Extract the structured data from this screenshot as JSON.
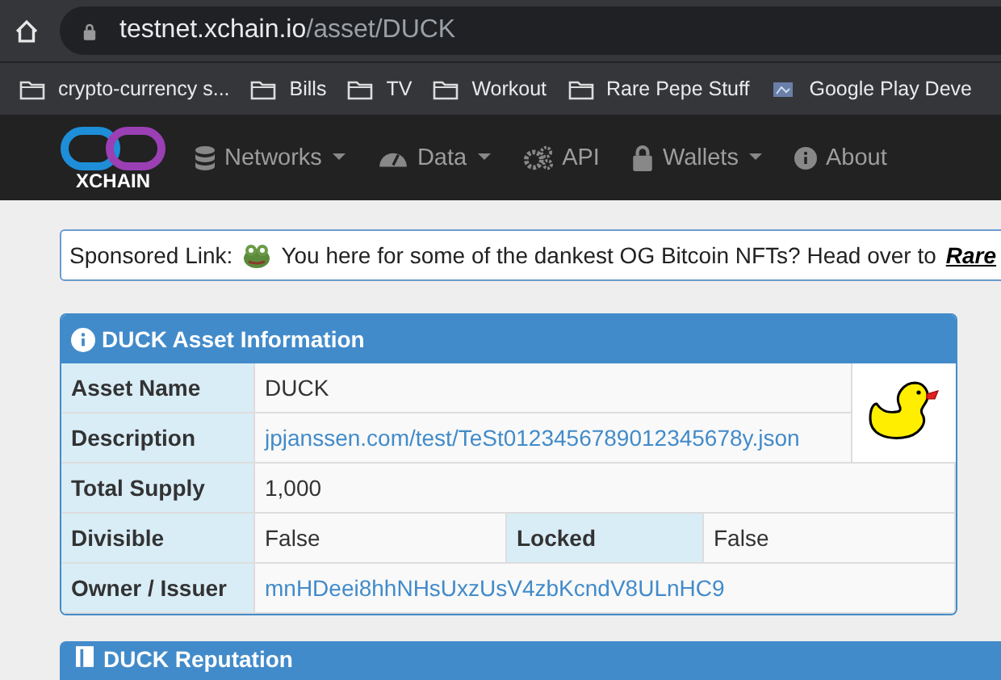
{
  "browser": {
    "url_host": "testnet.xchain.io",
    "url_path": "/asset/DUCK",
    "bookmarks": [
      {
        "label": "crypto-currency s...",
        "kind": "folder"
      },
      {
        "label": "Bills",
        "kind": "folder"
      },
      {
        "label": "TV",
        "kind": "folder"
      },
      {
        "label": "Workout",
        "kind": "folder"
      },
      {
        "label": "Rare Pepe Stuff",
        "kind": "folder"
      },
      {
        "label": "Google Play Deve",
        "kind": "page"
      }
    ]
  },
  "navbar": {
    "logo_text": "XCHAIN",
    "items": [
      {
        "label": "Networks",
        "kind": "database",
        "dropdown": true
      },
      {
        "label": "Data",
        "kind": "gauge",
        "dropdown": true
      },
      {
        "label": "API",
        "kind": "gears",
        "dropdown": false
      },
      {
        "label": "Wallets",
        "kind": "lock",
        "dropdown": true
      },
      {
        "label": "About",
        "kind": "info",
        "dropdown": false
      }
    ]
  },
  "sponsored": {
    "label": "Sponsored Link:",
    "text": "You here for some of the dankest OG Bitcoin NFTs? Head over to",
    "link": "Rare"
  },
  "asset_panel": {
    "title": "DUCK Asset Information",
    "rows": [
      {
        "label": "Asset Name",
        "value": "DUCK",
        "kind": "text"
      },
      {
        "label": "Description",
        "value": "jpjanssen.com/test/TeSt0123456789012345678y.json",
        "kind": "link"
      },
      {
        "label": "Total Supply",
        "value": "1,000",
        "kind": "text"
      },
      {
        "label": "Divisible",
        "value": "False",
        "kind": "pair",
        "label_2": "Locked",
        "value_2": "False"
      },
      {
        "label": "Owner / Issuer",
        "value": "mnHDeei8hhNHsUxzUsV4zbKcndV8ULnHC9",
        "kind": "link"
      }
    ]
  },
  "reputation_panel": {
    "title": "DUCK Reputation"
  }
}
